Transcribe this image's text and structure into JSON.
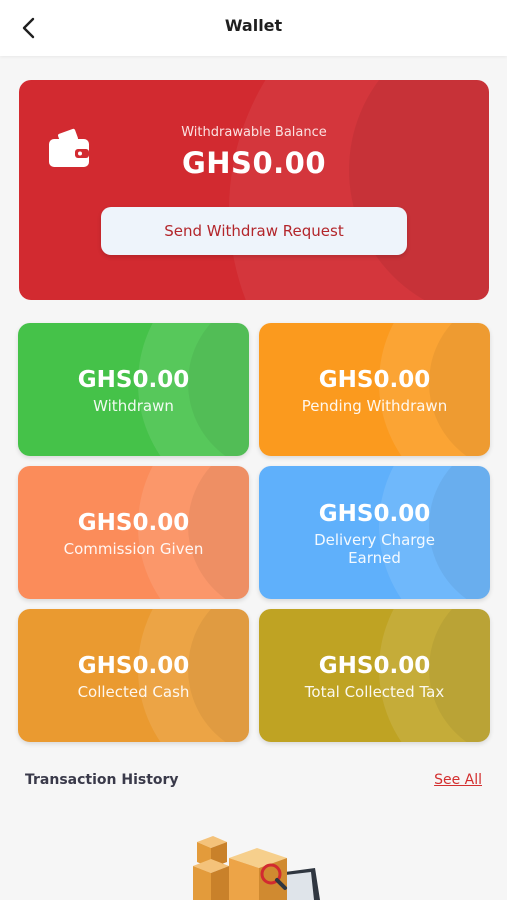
{
  "header": {
    "title": "Wallet",
    "back_icon": "back-arrow-icon"
  },
  "balance_card": {
    "icon": "wallet-icon",
    "label": "Withdrawable Balance",
    "amount": "GHS0.00",
    "button_label": "Send Withdraw Request",
    "color": "#d22a30"
  },
  "stats": [
    {
      "amount": "GHS0.00",
      "label": "Withdrawn",
      "color": "#45c249"
    },
    {
      "amount": "GHS0.00",
      "label": "Pending Withdrawn",
      "color": "#fb9a1e"
    },
    {
      "amount": "GHS0.00",
      "label": "Commission Given",
      "color": "#fb8c5a"
    },
    {
      "amount": "GHS0.00",
      "label_line1": "Delivery Charge",
      "label_line2": "Earned",
      "color": "#5fb0fb"
    },
    {
      "amount": "GHS0.00",
      "label": "Collected Cash",
      "color": "#ea9a30"
    },
    {
      "amount": "GHS0.00",
      "label": "Total Collected Tax",
      "color": "#bfa323"
    }
  ],
  "transactions": {
    "title": "Transaction History",
    "see_all": "See All",
    "empty_illustration": "boxes-illustration"
  }
}
